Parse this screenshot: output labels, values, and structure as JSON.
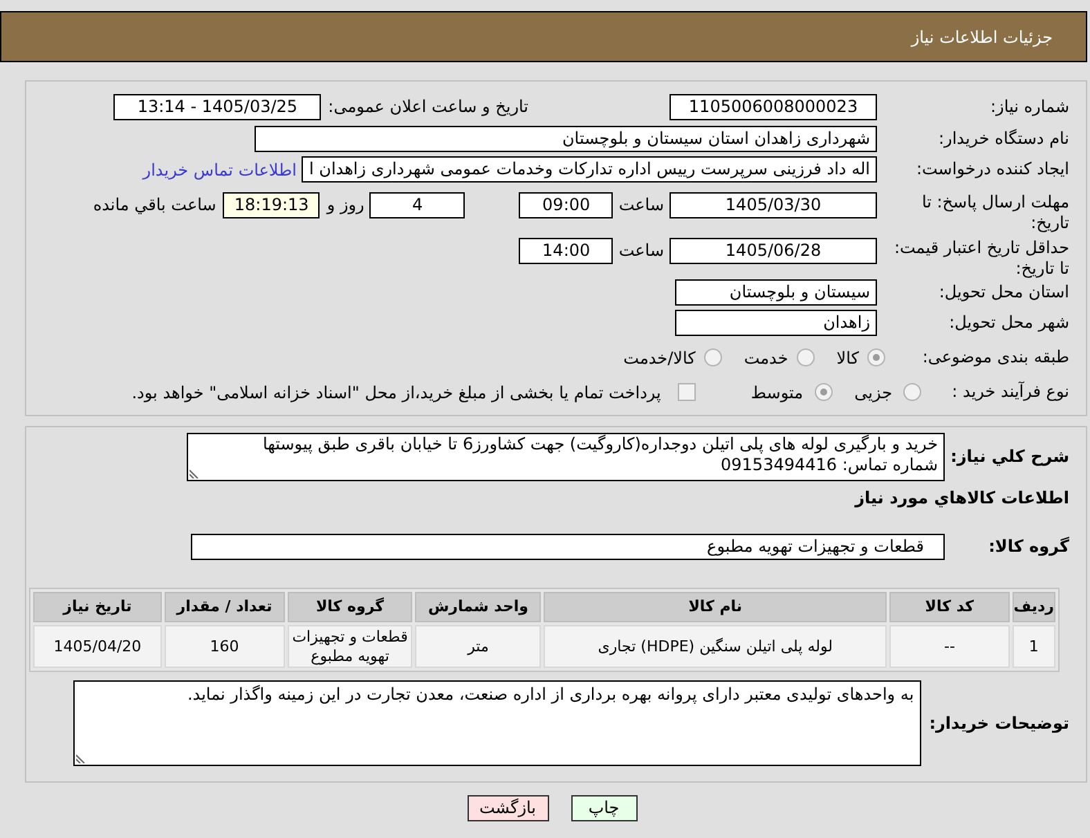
{
  "header": {
    "title": "جزئیات اطلاعات نیاز"
  },
  "details": {
    "need_number": {
      "label": "شماره نیاز:",
      "value": "1105006008000023"
    },
    "announcement": {
      "label": "تاریخ و ساعت اعلان عمومی:",
      "value": "1405/03/25 - 13:14"
    },
    "buyer_org": {
      "label": "نام دستگاه خریدار:",
      "value": "شهرداری زاهدان استان سیستان و بلوچستان"
    },
    "requester": {
      "label": "ایجاد کننده درخواست:",
      "value": "اله داد فرزینی سرپرست رییس اداره تدارکات وخدمات عمومی شهرداری زاهدان ا",
      "link": "اطلاعات تماس خریدار"
    },
    "reply_deadline": {
      "label": "مهلت ارسال پاسخ: تا تاریخ:",
      "date": "1405/03/30",
      "time_label": "ساعت",
      "time": "09:00",
      "days": "4",
      "days_label": "روز و",
      "remaining": "18:19:13",
      "remaining_label": "ساعت باقي مانده"
    },
    "price_validity": {
      "label": "حداقل تاریخ اعتبار قیمت: تا تاریخ:",
      "date": "1405/06/28",
      "time_label": "ساعت",
      "time": "14:00"
    },
    "province": {
      "label": "استان محل تحویل:",
      "value": "سیستان و بلوچستان"
    },
    "city": {
      "label": "شهر محل تحویل:",
      "value": "زاهدان"
    },
    "category": {
      "label": "طبقه بندی موضوعی:",
      "disabled": true,
      "options": [
        {
          "label": "کالا",
          "selected": true
        },
        {
          "label": "خدمت",
          "selected": false
        },
        {
          "label": "کالا/خدمت",
          "selected": false
        }
      ]
    },
    "process": {
      "label": "نوع فرآیند خرید :",
      "disabled": true,
      "options": [
        {
          "label": "جزیی",
          "selected": false
        },
        {
          "label": "متوسط",
          "selected": true
        }
      ],
      "treasury": {
        "label": "پرداخت تمام یا بخشی از مبلغ خرید،از محل \"اسناد خزانه اسلامی\" خواهد بود.",
        "checked": false
      }
    }
  },
  "needs": {
    "description": {
      "label": "شرح کلي نیاز:",
      "value": "خرید و بارگیری لوله های پلی اتیلن دوجداره(کاروگیت) جهت کشاورز6 تا خیابان باقری طبق پیوستها شماره تماس: 09153494416"
    },
    "goods_title": "اطلاعات کالاهاي مورد نیاز",
    "group": {
      "label": "گروه کالا:",
      "value": "قطعات و تجهیزات تهویه مطبوع"
    },
    "table": {
      "columns": [
        "ردیف",
        "کد کالا",
        "نام کالا",
        "واحد شمارش",
        "گروه کالا",
        "تعداد / مقدار",
        "تاریخ نیاز"
      ],
      "rows": [
        [
          "1",
          "--",
          "لوله پلی اتیلن سنگین (HDPE) تجاری",
          "متر",
          "قطعات و تجهیزات تهویه مطبوع",
          "160",
          "1405/04/20"
        ]
      ]
    },
    "buyer_notes": {
      "label": "توضیحات خریدار:",
      "value": "به واحدهای تولیدی معتبر دارای پروانه بهره برداری از اداره صنعت، معدن تجارت در این زمینه واگذار نماید."
    }
  },
  "buttons": [
    {
      "label": "چاپ",
      "kind": "print"
    },
    {
      "label": "بازگشت",
      "kind": "back"
    }
  ]
}
